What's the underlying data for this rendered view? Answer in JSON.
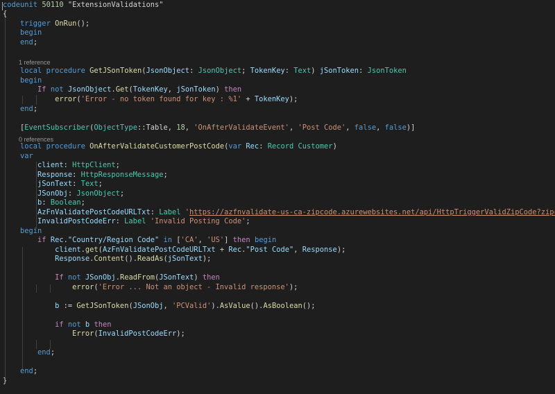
{
  "editor": {
    "colors": {
      "background": "#1e1e1e",
      "keyword": "#569cd6",
      "control": "#c586c0",
      "function": "#dcdcaa",
      "type": "#4ec9b0",
      "parameter": "#9cdcfe",
      "string": "#ce9178",
      "number": "#b5cea8",
      "text": "#d4d4d4",
      "codelens": "#999999"
    },
    "codelens": {
      "get_json_token_refs": "1 reference",
      "on_after_validate_refs": "0 references"
    },
    "lines": [
      [
        [
          "kw",
          "codeunit"
        ],
        [
          "tx",
          " "
        ],
        [
          "nu",
          "50110"
        ],
        [
          "tx",
          " "
        ],
        [
          "tx",
          "\"ExtensionValidations\""
        ]
      ],
      [
        [
          "tx",
          "{"
        ]
      ],
      [
        [
          "tx",
          "    "
        ],
        [
          "kw",
          "trigger"
        ],
        [
          "tx",
          " "
        ],
        [
          "fn",
          "OnRun"
        ],
        [
          "tx",
          "();"
        ]
      ],
      [
        [
          "tx",
          "    "
        ],
        [
          "kw",
          "begin"
        ]
      ],
      [
        [
          "tx",
          "    "
        ],
        [
          "kw",
          "end"
        ],
        [
          "tx",
          ";"
        ]
      ],
      [],
      [
        [
          "tx",
          "    "
        ],
        [
          "kw",
          "local"
        ],
        [
          "tx",
          " "
        ],
        [
          "kw",
          "procedure"
        ],
        [
          "tx",
          " "
        ],
        [
          "fn",
          "GetJSonToken"
        ],
        [
          "tx",
          "("
        ],
        [
          "pa",
          "JsonObject"
        ],
        [
          "tx",
          ": "
        ],
        [
          "ty",
          "JsonObject"
        ],
        [
          "tx",
          "; "
        ],
        [
          "pa",
          "TokenKey"
        ],
        [
          "tx",
          ": "
        ],
        [
          "ty",
          "Text"
        ],
        [
          "tx",
          ") "
        ],
        [
          "pa",
          "jSonToken"
        ],
        [
          "tx",
          ": "
        ],
        [
          "ty",
          "JsonToken"
        ]
      ],
      [
        [
          "tx",
          "    "
        ],
        [
          "kw",
          "begin"
        ]
      ],
      [
        [
          "tx",
          "        "
        ],
        [
          "ctl",
          "If"
        ],
        [
          "tx",
          " "
        ],
        [
          "kw",
          "not"
        ],
        [
          "tx",
          " "
        ],
        [
          "pa",
          "JsonObject"
        ],
        [
          "tx",
          "."
        ],
        [
          "fn",
          "Get"
        ],
        [
          "tx",
          "("
        ],
        [
          "pa",
          "TokenKey"
        ],
        [
          "tx",
          ", "
        ],
        [
          "pa",
          "jSonToken"
        ],
        [
          "tx",
          ") "
        ],
        [
          "ctl",
          "then"
        ]
      ],
      [
        [
          "tx",
          "            "
        ],
        [
          "fn",
          "error"
        ],
        [
          "tx",
          "("
        ],
        [
          "st",
          "'Error - no token found for key : %1'"
        ],
        [
          "tx",
          " + "
        ],
        [
          "pa",
          "TokenKey"
        ],
        [
          "tx",
          ");"
        ]
      ],
      [
        [
          "tx",
          "    "
        ],
        [
          "kw",
          "end"
        ],
        [
          "tx",
          ";"
        ]
      ],
      [],
      [
        [
          "tx",
          "    ["
        ],
        [
          "ty",
          "EventSubscriber"
        ],
        [
          "tx",
          "("
        ],
        [
          "ty",
          "ObjectType"
        ],
        [
          "tx",
          "::"
        ],
        [
          "tx",
          "Table"
        ],
        [
          "tx",
          ", "
        ],
        [
          "nu",
          "18"
        ],
        [
          "tx",
          ", "
        ],
        [
          "st",
          "'OnAfterValidateEvent'"
        ],
        [
          "tx",
          ", "
        ],
        [
          "st",
          "'Post Code'"
        ],
        [
          "tx",
          ", "
        ],
        [
          "kw",
          "false"
        ],
        [
          "tx",
          ", "
        ],
        [
          "kw",
          "false"
        ],
        [
          "tx",
          ")]"
        ]
      ],
      [
        [
          "tx",
          "    "
        ],
        [
          "kw",
          "local"
        ],
        [
          "tx",
          " "
        ],
        [
          "kw",
          "procedure"
        ],
        [
          "tx",
          " "
        ],
        [
          "fn",
          "OnAfterValidateCustomerPostCode"
        ],
        [
          "tx",
          "("
        ],
        [
          "kw",
          "var"
        ],
        [
          "tx",
          " "
        ],
        [
          "pa",
          "Rec"
        ],
        [
          "tx",
          ": "
        ],
        [
          "ty",
          "Record"
        ],
        [
          "tx",
          " "
        ],
        [
          "ty",
          "Customer"
        ],
        [
          "tx",
          ")"
        ]
      ],
      [
        [
          "tx",
          "    "
        ],
        [
          "kw",
          "var"
        ]
      ],
      [
        [
          "tx",
          "        "
        ],
        [
          "pa",
          "client"
        ],
        [
          "tx",
          ": "
        ],
        [
          "ty",
          "HttpClient"
        ],
        [
          "tx",
          ";"
        ]
      ],
      [
        [
          "tx",
          "        "
        ],
        [
          "pa",
          "Response"
        ],
        [
          "tx",
          ": "
        ],
        [
          "ty",
          "HttpResponseMessage"
        ],
        [
          "tx",
          ";"
        ]
      ],
      [
        [
          "tx",
          "        "
        ],
        [
          "pa",
          "jSonText"
        ],
        [
          "tx",
          ": "
        ],
        [
          "ty",
          "Text"
        ],
        [
          "tx",
          ";"
        ]
      ],
      [
        [
          "tx",
          "        "
        ],
        [
          "pa",
          "JSonObj"
        ],
        [
          "tx",
          ": "
        ],
        [
          "ty",
          "JsonObject"
        ],
        [
          "tx",
          ";"
        ]
      ],
      [
        [
          "tx",
          "        "
        ],
        [
          "pa",
          "b"
        ],
        [
          "tx",
          ": "
        ],
        [
          "ty",
          "Boolean"
        ],
        [
          "tx",
          ";"
        ]
      ],
      [
        [
          "tx",
          "        "
        ],
        [
          "pa",
          "AzFnValidatePostCodeURLTxt"
        ],
        [
          "tx",
          ": "
        ],
        [
          "ty",
          "Label"
        ],
        [
          "tx",
          " "
        ],
        [
          "st",
          "'"
        ],
        [
          "stu",
          "https://azfnvalidate-us-ca-zipcode.azurewebsites.net/api/HttpTriggerValidZipCode?zipcode="
        ],
        [
          "st",
          "'"
        ],
        [
          "tx",
          ";"
        ]
      ],
      [
        [
          "tx",
          "        "
        ],
        [
          "pa",
          "InvalidPostCodeErr"
        ],
        [
          "tx",
          ": "
        ],
        [
          "ty",
          "Label"
        ],
        [
          "tx",
          " "
        ],
        [
          "st",
          "'Invalid Posting Code'"
        ],
        [
          "tx",
          ";"
        ]
      ],
      [
        [
          "tx",
          "    "
        ],
        [
          "kw",
          "begin"
        ]
      ],
      [
        [
          "tx",
          "        "
        ],
        [
          "ctl",
          "if"
        ],
        [
          "tx",
          " "
        ],
        [
          "pa",
          "Rec"
        ],
        [
          "tx",
          "."
        ],
        [
          "pa",
          "\"Country/Region Code\""
        ],
        [
          "tx",
          " "
        ],
        [
          "kw",
          "in"
        ],
        [
          "tx",
          " ["
        ],
        [
          "st",
          "'CA'"
        ],
        [
          "tx",
          ", "
        ],
        [
          "st",
          "'US'"
        ],
        [
          "tx",
          "] "
        ],
        [
          "ctl",
          "then"
        ],
        [
          "tx",
          " "
        ],
        [
          "kw",
          "begin"
        ]
      ],
      [
        [
          "tx",
          "            "
        ],
        [
          "pa",
          "client"
        ],
        [
          "tx",
          "."
        ],
        [
          "fn",
          "get"
        ],
        [
          "tx",
          "("
        ],
        [
          "pa",
          "AzFnValidatePostCodeURLTxt"
        ],
        [
          "tx",
          " + "
        ],
        [
          "pa",
          "Rec"
        ],
        [
          "tx",
          "."
        ],
        [
          "pa",
          "\"Post Code\""
        ],
        [
          "tx",
          ", "
        ],
        [
          "pa",
          "Response"
        ],
        [
          "tx",
          ");"
        ]
      ],
      [
        [
          "tx",
          "            "
        ],
        [
          "pa",
          "Response"
        ],
        [
          "tx",
          "."
        ],
        [
          "fn",
          "Content"
        ],
        [
          "tx",
          "()."
        ],
        [
          "fn",
          "ReadAs"
        ],
        [
          "tx",
          "("
        ],
        [
          "pa",
          "jSonText"
        ],
        [
          "tx",
          ");"
        ]
      ],
      [],
      [
        [
          "tx",
          "            "
        ],
        [
          "ctl",
          "If"
        ],
        [
          "tx",
          " "
        ],
        [
          "kw",
          "not"
        ],
        [
          "tx",
          " "
        ],
        [
          "pa",
          "JSonObj"
        ],
        [
          "tx",
          "."
        ],
        [
          "fn",
          "ReadFrom"
        ],
        [
          "tx",
          "("
        ],
        [
          "pa",
          "JSonText"
        ],
        [
          "tx",
          ") "
        ],
        [
          "ctl",
          "then"
        ]
      ],
      [
        [
          "tx",
          "                "
        ],
        [
          "fn",
          "error"
        ],
        [
          "tx",
          "("
        ],
        [
          "st",
          "'Error ... Not an object - Invalid response'"
        ],
        [
          "tx",
          ");"
        ]
      ],
      [],
      [
        [
          "tx",
          "            "
        ],
        [
          "pa",
          "b"
        ],
        [
          "tx",
          " := "
        ],
        [
          "fn",
          "GetJSonToken"
        ],
        [
          "tx",
          "("
        ],
        [
          "pa",
          "JSonObj"
        ],
        [
          "tx",
          ", "
        ],
        [
          "st",
          "'PCValid'"
        ],
        [
          "tx",
          ")."
        ],
        [
          "fn",
          "AsValue"
        ],
        [
          "tx",
          "()."
        ],
        [
          "fn",
          "AsBoolean"
        ],
        [
          "tx",
          "();"
        ]
      ],
      [],
      [
        [
          "tx",
          "            "
        ],
        [
          "ctl",
          "if"
        ],
        [
          "tx",
          " "
        ],
        [
          "kw",
          "not"
        ],
        [
          "tx",
          " "
        ],
        [
          "pa",
          "b"
        ],
        [
          "tx",
          " "
        ],
        [
          "ctl",
          "then"
        ]
      ],
      [
        [
          "tx",
          "                "
        ],
        [
          "fn",
          "Error"
        ],
        [
          "tx",
          "("
        ],
        [
          "pa",
          "InvalidPostCodeErr"
        ],
        [
          "tx",
          ");"
        ]
      ],
      [],
      [
        [
          "tx",
          "        "
        ],
        [
          "kw",
          "end"
        ],
        [
          "tx",
          ";"
        ]
      ],
      [],
      [
        [
          "tx",
          "    "
        ],
        [
          "kw",
          "end"
        ],
        [
          "tx",
          ";"
        ]
      ],
      [
        [
          "tx",
          "}"
        ]
      ]
    ]
  }
}
